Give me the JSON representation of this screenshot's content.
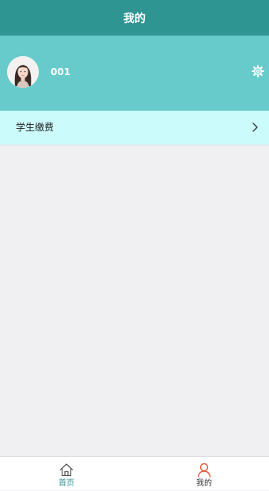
{
  "header": {
    "title": "我的"
  },
  "profile": {
    "username": "001"
  },
  "menu": {
    "items": [
      {
        "label": "学生缴费"
      }
    ]
  },
  "tabbar": {
    "items": [
      {
        "label": "首页",
        "icon": "home-icon"
      },
      {
        "label": "我的",
        "icon": "user-icon"
      }
    ]
  },
  "colors": {
    "header_bg": "#2f9593",
    "profile_bg": "#67cbcc",
    "menu_row_bg": "#cbfbfb",
    "page_bg": "#f0eff2",
    "active_tab": "#2f9593",
    "user_icon": "#e0593a"
  }
}
